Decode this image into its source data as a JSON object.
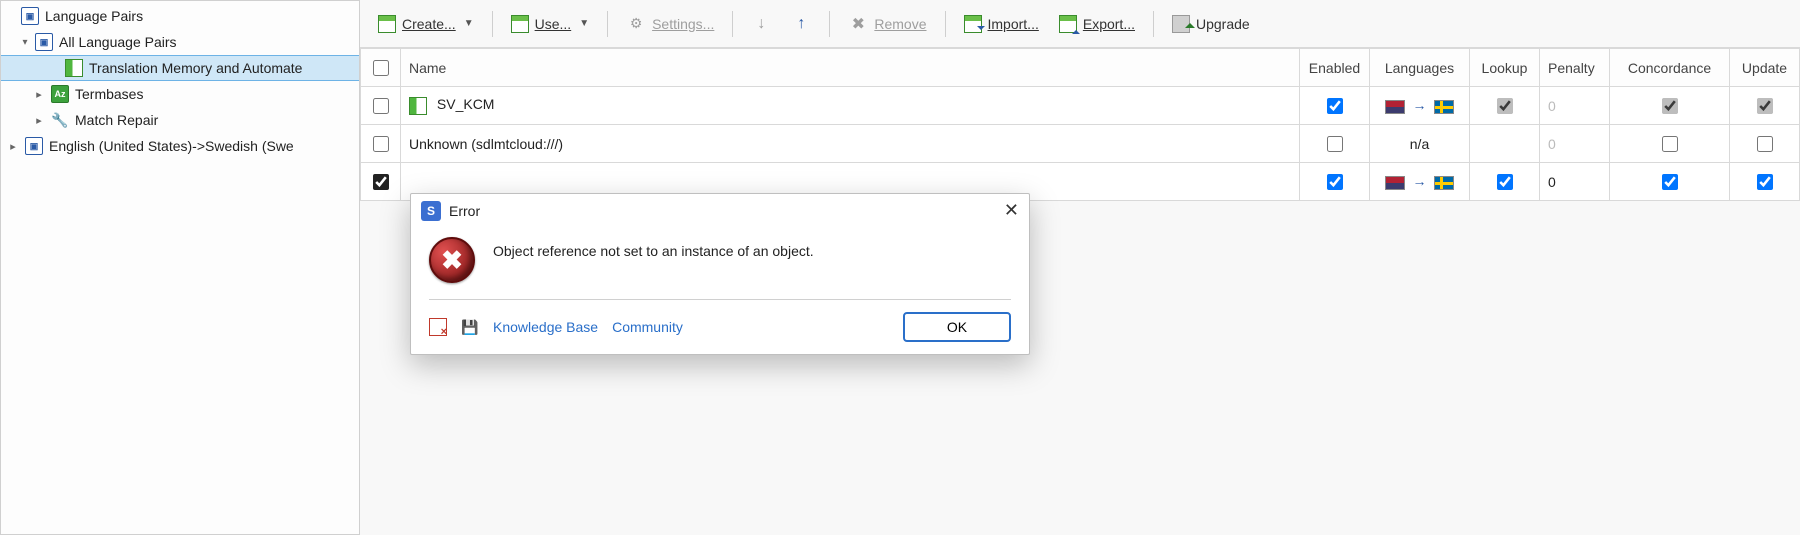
{
  "tree": {
    "root": "Language Pairs",
    "all": "All Language Pairs",
    "tm": "Translation Memory and Automate",
    "tb": "Termbases",
    "mr": "Match Repair",
    "pair": "English (United States)->Swedish (Swe"
  },
  "toolbar": {
    "create": "Create...",
    "use": "Use...",
    "settings": "Settings...",
    "remove": "Remove",
    "import": "Import...",
    "export": "Export...",
    "upgrade": "Upgrade"
  },
  "headers": {
    "name": "Name",
    "enabled": "Enabled",
    "languages": "Languages",
    "lookup": "Lookup",
    "penalty": "Penalty",
    "concordance": "Concordance",
    "update": "Update"
  },
  "rows": [
    {
      "name": "SV_KCM",
      "enabled": true,
      "lang": "us-se",
      "lookup": true,
      "penalty": "0",
      "penalty_dim": true,
      "concordance": true,
      "update": true,
      "grey": true
    },
    {
      "name": "Unknown (sdlmtcloud:///)",
      "enabled": false,
      "lang": "n/a",
      "lookup": false,
      "penalty": "0",
      "penalty_dim": true,
      "concordance": false,
      "update": false,
      "grey": true
    },
    {
      "name": "",
      "enabled": true,
      "lang": "us-se",
      "lookup": true,
      "penalty": "0",
      "penalty_dim": false,
      "concordance": true,
      "update": true,
      "grey": false,
      "checked_first": true
    }
  ],
  "dialog": {
    "title": "Error",
    "message": "Object reference not set to an instance of an object.",
    "kb": "Knowledge Base",
    "community": "Community",
    "ok": "OK",
    "app_letter": "S",
    "close": "✕",
    "err_glyph": "✖"
  }
}
